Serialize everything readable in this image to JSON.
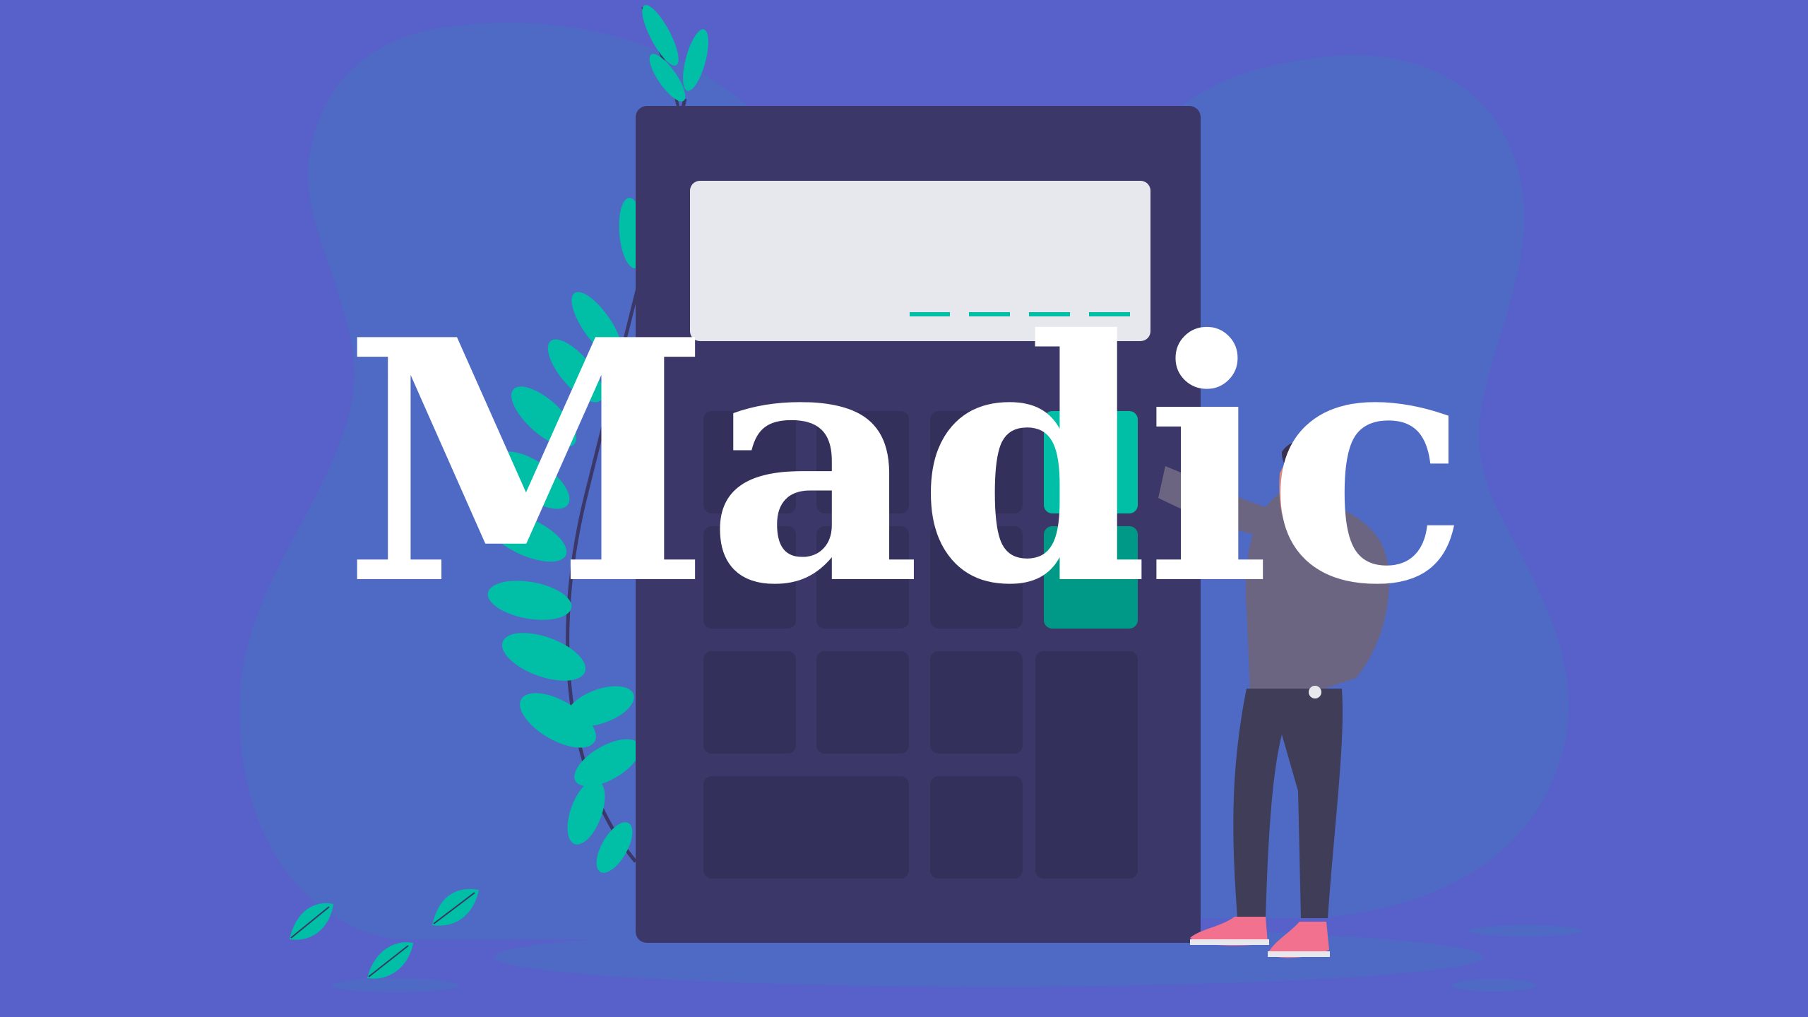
{
  "title": "Madic",
  "colors": {
    "background": "#5761c9",
    "blob": "#4f6ac5",
    "calculator_body": "#3b3768",
    "calculator_screen": "#e6e8ee",
    "calculator_key": "#33305c",
    "accent": "#00bfa6",
    "accent_dark": "#009987",
    "text": "#ffffff",
    "shirt": "#6b6582",
    "pants": "#403d58",
    "skin": "#d88b80",
    "hair": "#3a3150",
    "shoe": "#f2718e"
  },
  "illustration": {
    "subject": "calculator",
    "figure": "person",
    "decor": [
      "plant-leaves",
      "blobs"
    ]
  }
}
